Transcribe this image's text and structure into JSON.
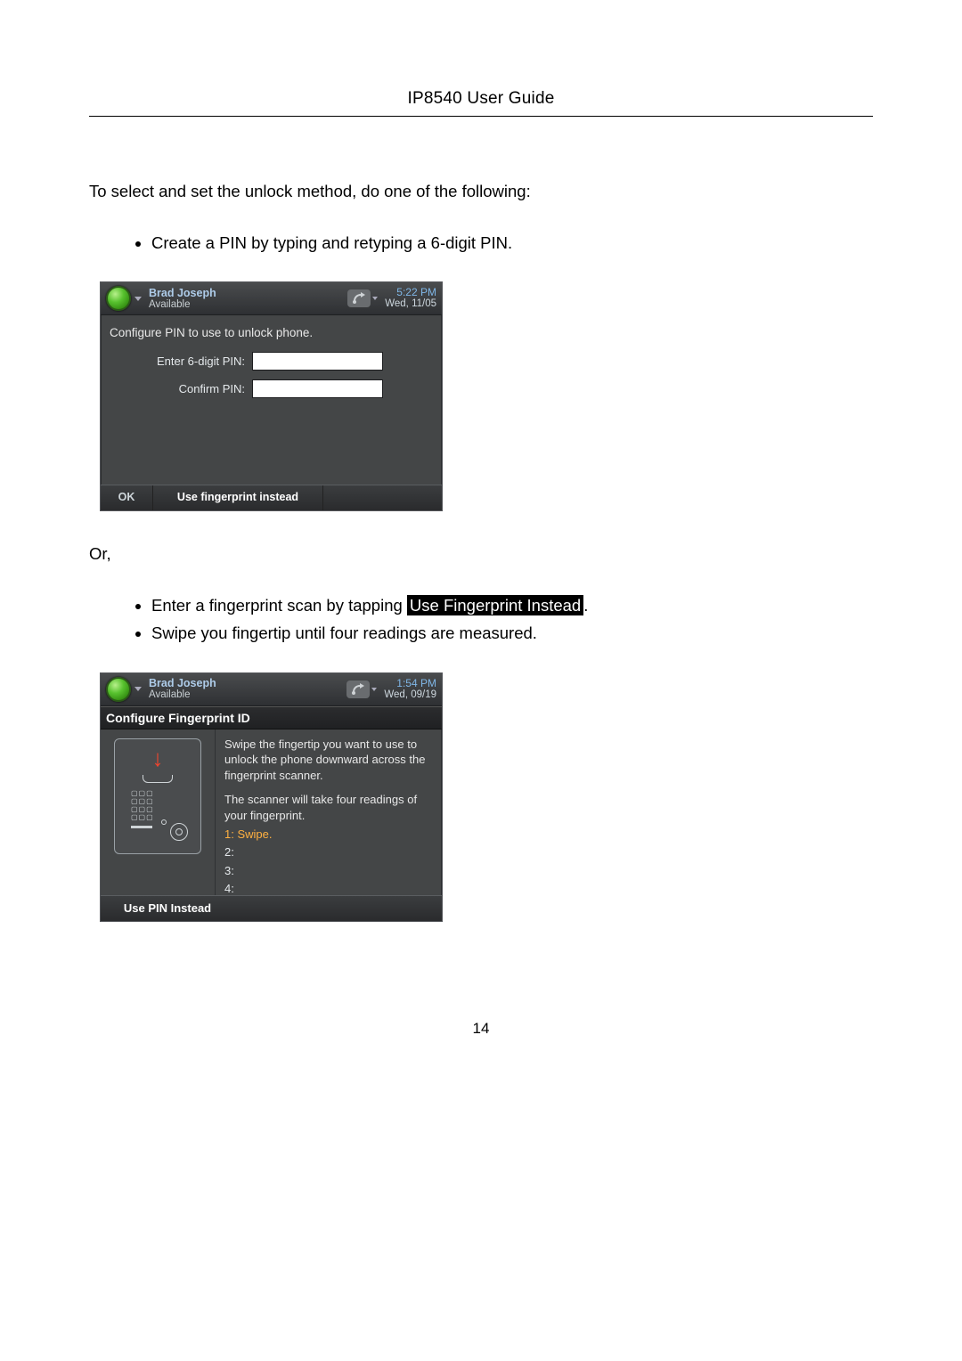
{
  "doc": {
    "header_title": "IP8540 User Guide",
    "intro": "To select and set the unlock method, do one of the following:",
    "bullet_pin": "Create a PIN by typing and retyping a 6-digit PIN.",
    "or_text": "Or,",
    "bullet_fp_enter_pre": "Enter a fingerprint scan by tapping ",
    "bullet_fp_enter_hl": "Use Fingerprint Instead",
    "bullet_fp_enter_post": ".",
    "bullet_fp_swipe": "Swipe you fingertip until four readings are measured.",
    "page_number": "14"
  },
  "pin_screen": {
    "user_name": "Brad Joseph",
    "user_status": "Available",
    "time": "5:22 PM",
    "date": "Wed, 11/05",
    "instruction": "Configure PIN to use to unlock phone.",
    "enter_label": "Enter 6-digit PIN:",
    "confirm_label": "Confirm PIN:",
    "softkey_ok": "OK",
    "softkey_fp": "Use fingerprint instead"
  },
  "fp_screen": {
    "user_name": "Brad Joseph",
    "user_status": "Available",
    "time": "1:54 PM",
    "date": "Wed, 09/19",
    "title": "Configure Fingerprint ID",
    "instruction1": "Swipe the fingertip you want to use to unlock the phone downward across the fingerprint scanner.",
    "instruction2": "The scanner will take four readings of your fingerprint.",
    "step1": "1:  Swipe.",
    "step2": "2:",
    "step3": "3:",
    "step4": "4:",
    "softkey_pin": "Use PIN Instead"
  }
}
